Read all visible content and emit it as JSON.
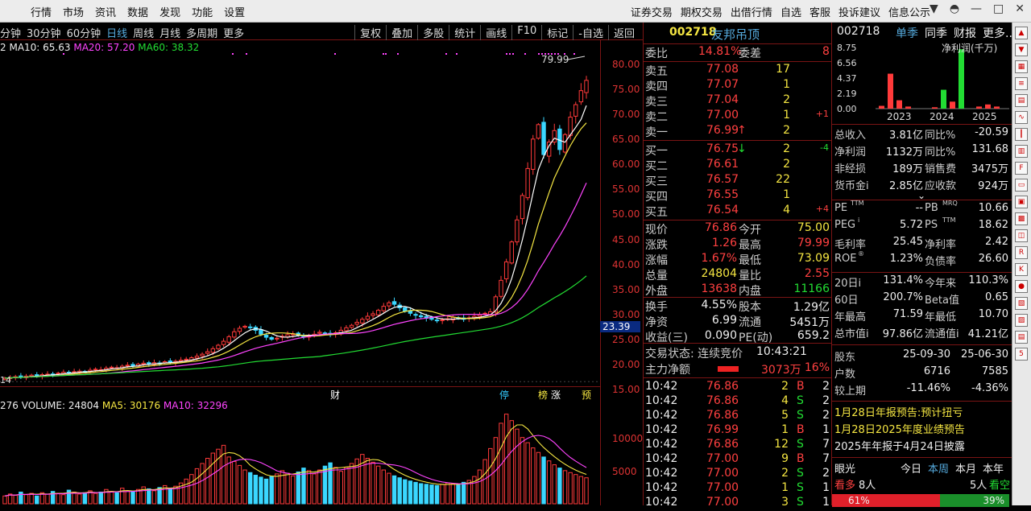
{
  "menu": {
    "items": [
      "行情",
      "市场",
      "资讯",
      "数据",
      "发现",
      "功能",
      "设置"
    ]
  },
  "menu_right": {
    "items": [
      "证券交易",
      "期权交易",
      "出借行情",
      "自选",
      "客服",
      "投诉建议",
      "信息公示"
    ]
  },
  "toolbar": {
    "periods": [
      "分钟",
      "30分钟",
      "60分钟",
      "日线",
      "周线",
      "月线",
      "多周期",
      "更多"
    ],
    "active_period": "日线",
    "tools": [
      "复权",
      "叠加",
      "多股",
      "统计",
      "画线",
      "F10",
      "标记",
      "-自选",
      "返回"
    ]
  },
  "ma": {
    "prefix": "2",
    "ma10": "MA10: 65.63",
    "ma20": "MA20: 57.20",
    "ma60": "MA60: 38.32"
  },
  "price_axis": [
    "80.00",
    "75.00",
    "70.00",
    "65.00",
    "60.00",
    "55.00",
    "50.00",
    "45.00",
    "40.00",
    "35.00",
    "30.00",
    "25.00",
    "20.00",
    "15.00"
  ],
  "high_label": "79.99",
  "low_label": "14",
  "current_price_tag": "23.39",
  "events": [
    "财",
    "停",
    "榜",
    "涨",
    "预"
  ],
  "volume": {
    "prefix": "276",
    "vol": "VOLUME: 24804",
    "ma5": "MA5: 30176",
    "ma10": "MA10: 32296",
    "axis": [
      "10000",
      "5000"
    ]
  },
  "colors": {
    "up": "#ff3a3a",
    "down": "#3ad7ff",
    "ma5": "#ffffff",
    "ma10": "#f5e642",
    "ma20": "#ff44ff",
    "ma60": "#22dd33"
  },
  "chart_data": {
    "type": "candlestick",
    "ylim": [
      13,
      82
    ],
    "closes": [
      17.2,
      17.3,
      17.5,
      17.4,
      17.6,
      17.8,
      17.7,
      17.9,
      18.0,
      17.9,
      18.2,
      18.4,
      18.3,
      18.5,
      18.6,
      18.5,
      18.8,
      19.0,
      18.9,
      19.2,
      19.4,
      19.3,
      19.6,
      19.8,
      19.7,
      20.0,
      20.2,
      20.1,
      20.3,
      20.2,
      20.5,
      20.4,
      20.6,
      20.8,
      21.0,
      21.3,
      21.6,
      22.0,
      22.5,
      23.1,
      23.8,
      24.6,
      25.5,
      26.5,
      27.2,
      27.6,
      27.4,
      26.8,
      26.0,
      25.4,
      25.0,
      25.2,
      25.6,
      25.9,
      26.1,
      25.8,
      25.5,
      25.7,
      26.0,
      26.4,
      26.2,
      25.9,
      26.3,
      26.8,
      27.3,
      27.8,
      28.4,
      29.0,
      29.6,
      30.1,
      30.8,
      31.6,
      32.3,
      32.0,
      31.3,
      30.6,
      30.2,
      29.8,
      29.5,
      29.2,
      29.0,
      28.8,
      28.9,
      29.1,
      29.4,
      29.2,
      29.0,
      29.3,
      29.6,
      29.9,
      30.2,
      30.5,
      33.5,
      36.8,
      40.5,
      44.5,
      48.9,
      53.8,
      59.2,
      65.1,
      68.0,
      62.0,
      64.5,
      66.8,
      63.0,
      66.0,
      69.5,
      72.0,
      74.8,
      76.86
    ],
    "volumes": [
      1200,
      1500,
      1300,
      1800,
      1400,
      1600,
      1200,
      1700,
      1500,
      1900,
      1600,
      1400,
      2100,
      1800,
      1500,
      1700,
      2000,
      1600,
      1800,
      2200,
      1900,
      1700,
      2400,
      2000,
      1800,
      2200,
      2600,
      2300,
      2000,
      2500,
      2800,
      2400,
      2700,
      3200,
      3800,
      4500,
      5400,
      6200,
      7000,
      7800,
      8400,
      9000,
      7200,
      6500,
      5900,
      5200,
      4800,
      4400,
      4100,
      3800,
      4200,
      4600,
      5100,
      4700,
      4300,
      4900,
      5500,
      5100,
      4600,
      5200,
      5800,
      6300,
      5600,
      5000,
      5600,
      6200,
      6900,
      7600,
      7000,
      6400,
      5800,
      5200,
      4700,
      4300,
      4000,
      3700,
      3500,
      3300,
      3100,
      3000,
      2900,
      2800,
      3000,
      3200,
      3100,
      2900,
      3300,
      3600,
      4200,
      5200,
      6800,
      8500,
      10200,
      12400,
      13800,
      12800,
      11500,
      10200,
      9400,
      8600,
      7900,
      7200,
      6600,
      6000,
      5500,
      5100,
      4800,
      4500,
      4200,
      4000
    ],
    "series": [
      {
        "name": "MA10",
        "last": 65.63
      },
      {
        "name": "MA20",
        "last": 57.2
      },
      {
        "name": "MA60",
        "last": 38.32
      }
    ]
  },
  "quote": {
    "code": "002718",
    "name": "友邦吊顶",
    "weibi_label": "委比",
    "weibi": "14.81%",
    "weicha_label": "委差",
    "weicha": "8",
    "sells": [
      {
        "label": "卖五",
        "price": "77.08",
        "vol": "17",
        "chg": ""
      },
      {
        "label": "卖四",
        "price": "77.07",
        "vol": "1",
        "chg": ""
      },
      {
        "label": "卖三",
        "price": "77.04",
        "vol": "2",
        "chg": ""
      },
      {
        "label": "卖二",
        "price": "77.00",
        "vol": "1",
        "chg": "+1"
      },
      {
        "label": "卖一",
        "price": "76.99",
        "vol": "2",
        "chg": "",
        "arrow": "↑"
      }
    ],
    "buys": [
      {
        "label": "买一",
        "price": "76.75",
        "vol": "2",
        "chg": "-4",
        "arrow": "↓"
      },
      {
        "label": "买二",
        "price": "76.61",
        "vol": "2",
        "chg": ""
      },
      {
        "label": "买三",
        "price": "76.57",
        "vol": "22",
        "chg": ""
      },
      {
        "label": "买四",
        "price": "76.55",
        "vol": "1",
        "chg": ""
      },
      {
        "label": "买五",
        "price": "76.54",
        "vol": "4",
        "chg": "+4"
      }
    ],
    "stats": [
      {
        "l1": "现价",
        "v1": "76.86",
        "c1": "red",
        "l2": "今开",
        "v2": "75.00",
        "c2": "yellow"
      },
      {
        "l1": "涨跌",
        "v1": "1.26",
        "c1": "red",
        "l2": "最高",
        "v2": "79.99",
        "c2": "red"
      },
      {
        "l1": "涨幅",
        "v1": "1.67%",
        "c1": "red",
        "l2": "最低",
        "v2": "73.09",
        "c2": "yellow"
      },
      {
        "l1": "总量",
        "v1": "24804",
        "c1": "yellow",
        "l2": "量比",
        "v2": "2.55",
        "c2": "red"
      },
      {
        "l1": "外盘",
        "v1": "13638",
        "c1": "red",
        "l2": "内盘",
        "v2": "11166",
        "c2": "green"
      }
    ],
    "stats2": [
      {
        "l1": "换手",
        "v1": "4.55%",
        "l2": "股本",
        "v2": "1.29亿"
      },
      {
        "l1": "净资",
        "v1": "6.99",
        "l2": "流通",
        "v2": "5451万"
      },
      {
        "l1": "收益(三)",
        "v1": "0.090",
        "l2": "PE(动)",
        "v2": "659.2"
      }
    ],
    "trade_status": "交易状态: 连续竞价",
    "trade_time": "10:43:21",
    "main_net_label": "主力净额",
    "main_net": "3073万",
    "main_net_pct": "16%",
    "ticks": [
      {
        "t": "10:42",
        "p": "76.86",
        "v": "2",
        "bs": "B",
        "n": "2"
      },
      {
        "t": "10:42",
        "p": "76.86",
        "v": "4",
        "bs": "S",
        "n": "2"
      },
      {
        "t": "10:42",
        "p": "76.86",
        "v": "5",
        "bs": "S",
        "n": "2"
      },
      {
        "t": "10:42",
        "p": "76.99",
        "v": "1",
        "bs": "B",
        "n": "1"
      },
      {
        "t": "10:42",
        "p": "76.86",
        "v": "12",
        "bs": "S",
        "n": "7"
      },
      {
        "t": "10:42",
        "p": "77.00",
        "v": "9",
        "bs": "B",
        "n": "7"
      },
      {
        "t": "10:42",
        "p": "77.00",
        "v": "2",
        "bs": "S",
        "n": "2"
      },
      {
        "t": "10:42",
        "p": "77.00",
        "v": "1",
        "bs": "S",
        "n": "1"
      },
      {
        "t": "10:42",
        "p": "77.00",
        "v": "3",
        "bs": "S",
        "n": "1"
      }
    ]
  },
  "info": {
    "code": "002718",
    "tabs": [
      "单季",
      "同季",
      "财报",
      "更多.."
    ],
    "mini_chart": {
      "yaxis": [
        "8.75",
        "6.56",
        "4.37",
        "2.19",
        "0.00"
      ],
      "xaxis": [
        "2023",
        "2024",
        "2025"
      ],
      "label": "净利润(千万)",
      "values": [
        0.4,
        5.0,
        1.2,
        0.3,
        0,
        0,
        0.2,
        2.7,
        1.0,
        8.5,
        0,
        0.3,
        0.6,
        0.3
      ],
      "color": "#22dd33"
    },
    "fin": [
      {
        "l1": "总收入",
        "v1": "3.81亿",
        "l2": "同比%",
        "v2": "-20.59"
      },
      {
        "l1": "净利润",
        "v1": "1132万",
        "l2": "同比%",
        "v2": "131.68"
      },
      {
        "l1": "非经损",
        "v1": "189万",
        "l2": "销售费",
        "v2": "3475万"
      },
      {
        "l1": "货币金i",
        "v1": "2.85亿",
        "l2": "应收款",
        "v2": "924万"
      }
    ],
    "ratios": [
      {
        "l1": "PE",
        "s1": "TTM",
        "v1": "--",
        "l2": "PB",
        "s2": "MRQ",
        "v2": "10.66"
      },
      {
        "l1": "PEG",
        "s1": "i",
        "v1": "5.72",
        "l2": "PS",
        "s2": "TTM",
        "v2": "18.62"
      },
      {
        "l1": "毛利率",
        "s1": "",
        "v1": "25.45",
        "l2": "净利率",
        "s2": "",
        "v2": "2.42"
      },
      {
        "l1": "ROE",
        "s1": "®",
        "v1": "1.23%",
        "l2": "负债率",
        "s2": "",
        "v2": "26.60"
      }
    ],
    "perf": [
      {
        "l1": "20日i",
        "v1": "131.4%",
        "l2": "今年来",
        "v2": "110.3%"
      },
      {
        "l1": "60日",
        "v1": "200.7%",
        "l2": "Beta值",
        "v2": "0.65"
      },
      {
        "l1": "年最高",
        "v1": "71.59",
        "l2": "年最低",
        "v2": "10.70"
      },
      {
        "l1": "总市值i",
        "v1": "97.86亿",
        "l2": "流通值i",
        "v2": "41.21亿"
      }
    ],
    "holders": [
      {
        "l": "股东",
        "a": "25-09-30",
        "b": "25-06-30"
      },
      {
        "l": "户数",
        "a": "6716",
        "b": "7585"
      },
      {
        "l": "较上期",
        "a": "-11.46%",
        "b": "-4.36%"
      }
    ],
    "notices": [
      "1月28日年报预告:预计扭亏",
      "1月28日2025年度业绩预告",
      "2025年年报于4月24日披露"
    ],
    "eyes_label": "眼光",
    "eyes_tabs": [
      "今日",
      "本周",
      "本月",
      "本年"
    ],
    "eyes_active": "本周",
    "bull_label": "看多",
    "bull_count": "8人",
    "bear_count": "5人",
    "bear_label": "看空",
    "bull_pct": "61%",
    "bear_pct": "39%"
  }
}
